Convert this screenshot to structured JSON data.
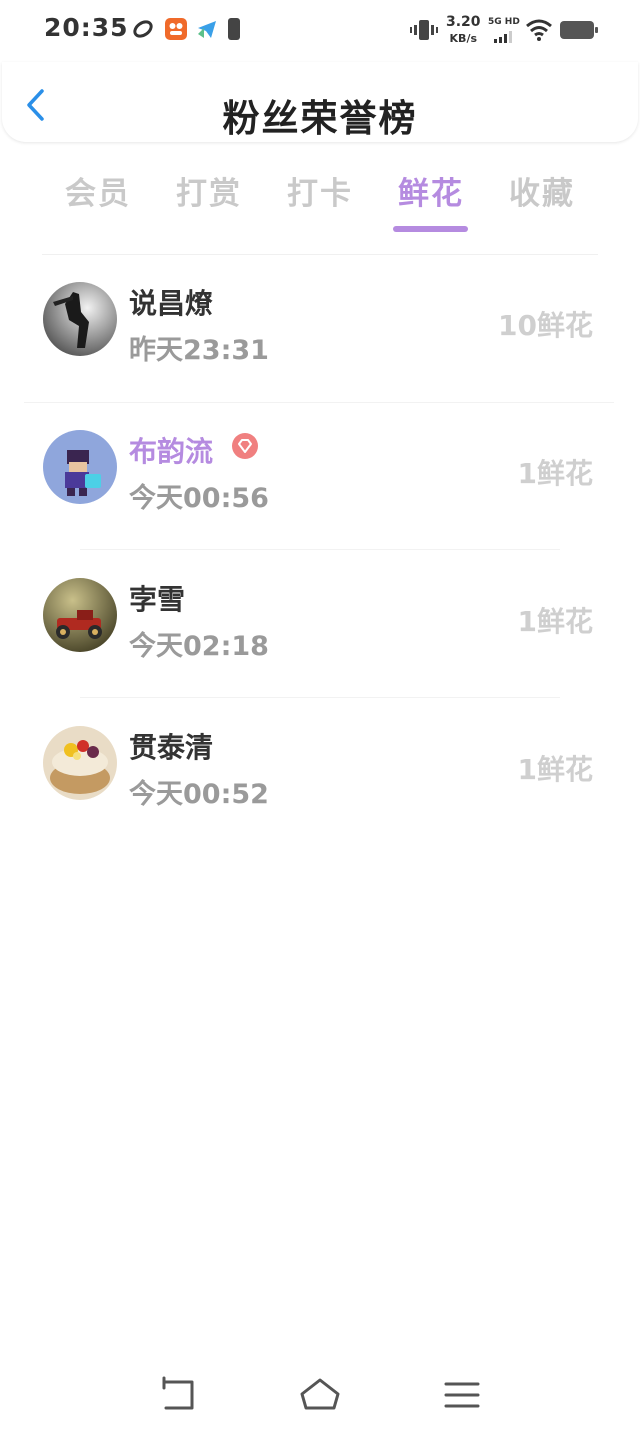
{
  "status_bar": {
    "time": "20:35",
    "net_speed_value": "3.20",
    "net_speed_unit": "KB/s",
    "net_type": "5G HD",
    "icons": [
      "notification-app-icon-1",
      "notification-app-icon-2",
      "notification-app-icon-3",
      "notification-app-icon-4",
      "vibrate-icon",
      "signal-icon",
      "wifi-icon",
      "battery-icon"
    ]
  },
  "header": {
    "title": "粉丝荣誉榜",
    "back_icon": "chevron-left-icon"
  },
  "tabs": [
    {
      "label": "会员",
      "active": false
    },
    {
      "label": "打赏",
      "active": false
    },
    {
      "label": "打卡",
      "active": false
    },
    {
      "label": "鲜花",
      "active": true
    },
    {
      "label": "收藏",
      "active": false
    }
  ],
  "list": [
    {
      "name": "说昌燎",
      "time": "昨天23:31",
      "amount": "10鲜花",
      "vip": false
    },
    {
      "name": "布韵流",
      "time": "今天00:56",
      "amount": "1鲜花",
      "vip": true
    },
    {
      "name": "孛雪",
      "time": "今天02:18",
      "amount": "1鲜花",
      "vip": false
    },
    {
      "name": "贯泰清",
      "time": "今天00:52",
      "amount": "1鲜花",
      "vip": false
    }
  ],
  "colors": {
    "accent": "#b58be0",
    "back": "#2a8fe8",
    "vip_badge": "#f08080"
  },
  "nav": {
    "icons": [
      "back-nav-icon",
      "home-icon",
      "menu-icon"
    ]
  }
}
